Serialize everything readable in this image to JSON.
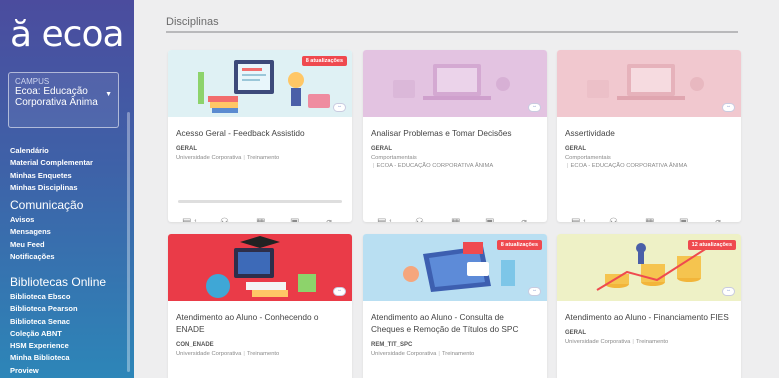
{
  "brand": {
    "logo": "ă ecoa"
  },
  "campus": {
    "label": "CAMPUS",
    "value": "Ecoa: Educação Corporativa Ânima"
  },
  "nav": {
    "main": [
      "Calendário",
      "Material Complementar",
      "Minhas Enquetes",
      "Minhas Disciplinas"
    ],
    "comunicacao_title": "Comunicação",
    "comunicacao": [
      "Avisos",
      "Mensagens",
      "Meu Feed",
      "Notificações"
    ],
    "bibliotecas_title": "Bibliotecas Online",
    "bibliotecas": [
      "Biblioteca Ebsco",
      "Biblioteca Pearson",
      "Biblioteca Senac",
      "Coleção ABNT",
      "HSM Experience",
      "Minha Biblioteca",
      "Proview"
    ]
  },
  "page": {
    "title": "Disciplinas"
  },
  "cards": [
    {
      "title": "Acesso Geral - Feedback Assistido",
      "badge": "8 atualizações",
      "code": "GERAL",
      "meta1": "Universidade Corporativa",
      "meta2": "Treinamento",
      "count": "1",
      "progress": 0,
      "banner_color": "#dff1f4"
    },
    {
      "title": "Analisar Problemas e Tomar Decisões",
      "code": "GERAL",
      "meta1": "Comportamentais",
      "meta2": "ECOA - EDUCAÇÃO CORPORATIVA ÂNIMA",
      "count": "1",
      "banner_color": "#e3c3e1"
    },
    {
      "title": "Assertividade",
      "code": "GERAL",
      "meta1": "Comportamentais",
      "meta2": "ECOA - EDUCAÇÃO CORPORATIVA ÂNIMA",
      "count": "1",
      "banner_color": "#f1c8cf"
    },
    {
      "title": "Atendimento ao Aluno - Conhecendo o ENADE",
      "code": "CON_ENADE",
      "meta1": "Universidade Corporativa",
      "meta2": "Treinamento",
      "banner_color": "#ea3b48"
    },
    {
      "title": "Atendimento ao Aluno - Consulta de Cheques e Remoção de Títulos do SPC",
      "badge": "8 atualizações",
      "code": "REM_TIT_SPC",
      "meta1": "Universidade Corporativa",
      "meta2": "Treinamento",
      "banner_color": "#b9dff2"
    },
    {
      "title": "Atendimento ao Aluno - Financiamento FIES",
      "badge": "12 atualizações",
      "code": "GERAL",
      "meta1": "Universidade Corporativa",
      "meta2": "Treinamento",
      "banner_color": "#eef1c6"
    }
  ],
  "colors": {
    "accent": "#4a6fb8",
    "badge": "#ef4a4f"
  },
  "icons": [
    "document-icon",
    "users-icon",
    "calendar-icon",
    "clipboard-icon",
    "attachment-icon",
    "chat-bubble-icon",
    "caret-down-icon"
  ]
}
